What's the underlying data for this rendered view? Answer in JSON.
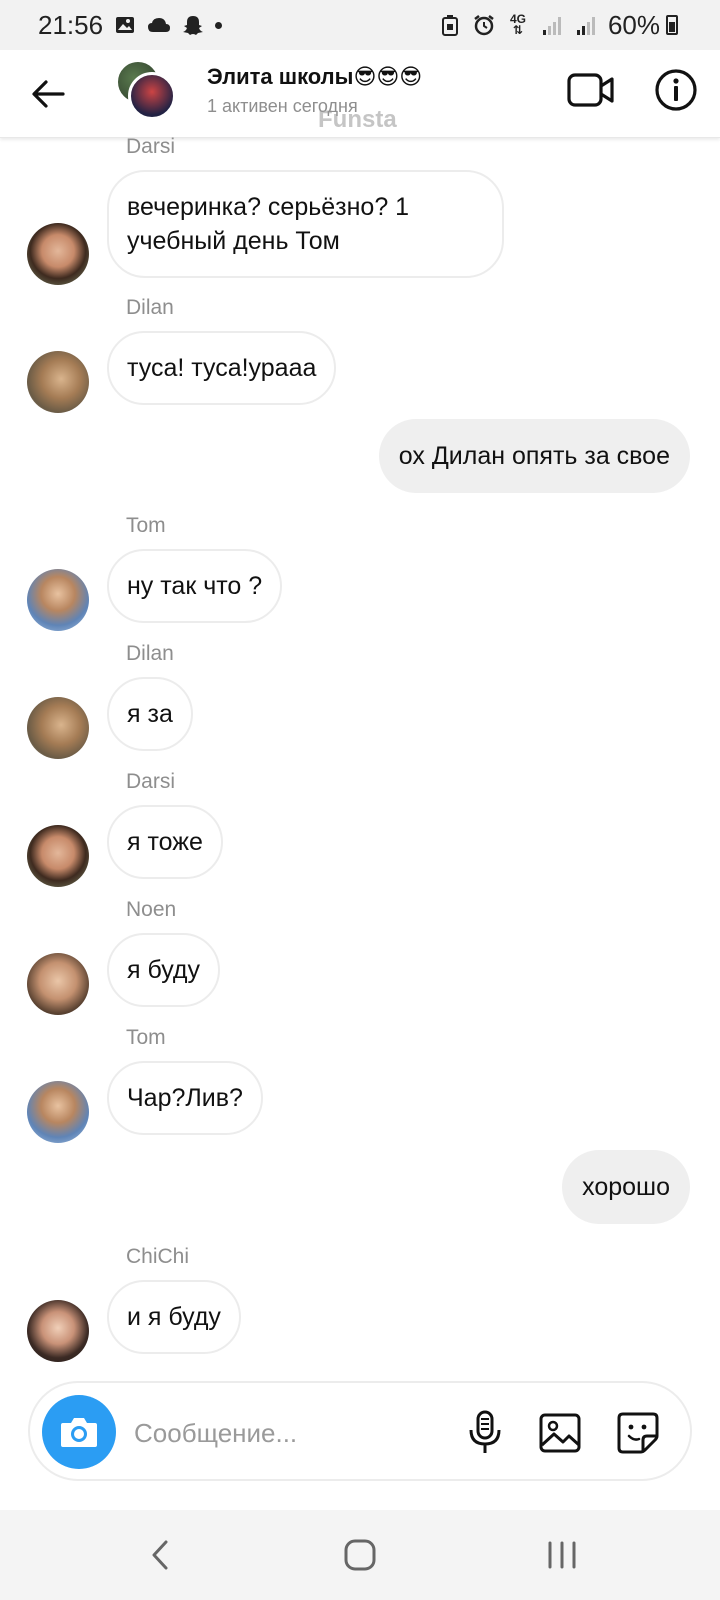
{
  "status_bar": {
    "time": "21:56",
    "battery": "60%",
    "network": "4G"
  },
  "header": {
    "group_name": "Элита школы😎😎😎",
    "status": "1 активен сегодня",
    "watermark": "Funsta"
  },
  "messages": [
    {
      "sender": "Darsi",
      "text": "вечеринка? серьёзно? 1 учебный день Том",
      "direction": "in"
    },
    {
      "sender": "Dilan",
      "text": "туса! туса!урааа",
      "direction": "in"
    },
    {
      "sender": "",
      "text": "ох Дилан опять за свое",
      "direction": "out"
    },
    {
      "sender": "Tom",
      "text": "ну так что ?",
      "direction": "in"
    },
    {
      "sender": "Dilan",
      "text": "я за",
      "direction": "in"
    },
    {
      "sender": "Darsi",
      "text": "я тоже",
      "direction": "in"
    },
    {
      "sender": "Noen",
      "text": "я буду",
      "direction": "in"
    },
    {
      "sender": "Tom",
      "text": "Чар?Лив?",
      "direction": "in"
    },
    {
      "sender": "",
      "text": "хорошо",
      "direction": "out"
    },
    {
      "sender": "ChiChi",
      "text": "и я буду",
      "direction": "in"
    }
  ],
  "composer": {
    "placeholder": "Сообщение..."
  },
  "colors": {
    "accent": "#2b9df3",
    "incoming_bubble_border": "#ececec",
    "outgoing_bubble": "#efefef",
    "secondary_text": "#8e8e8e"
  }
}
